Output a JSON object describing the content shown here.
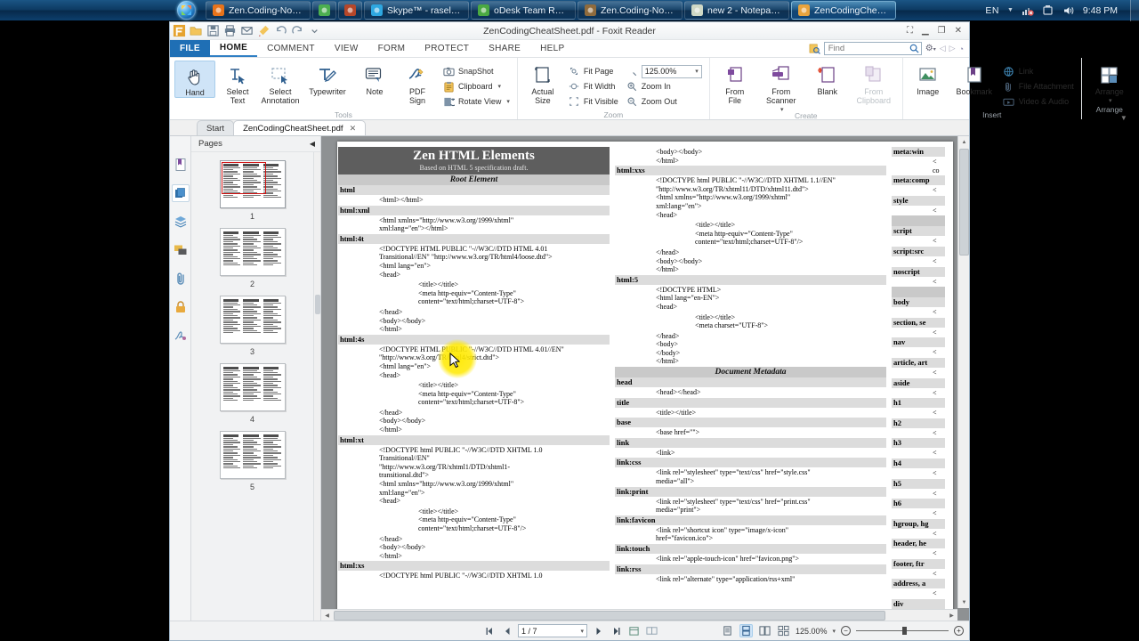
{
  "taskbar": {
    "items": [
      {
        "label": "Zen.Coding-Notep...",
        "icon": "firefox-icon",
        "color": "#e8731a",
        "active": false,
        "narrow": false
      },
      {
        "label": "",
        "icon": "chrome-icon",
        "color": "#4caf50",
        "active": false,
        "narrow": true
      },
      {
        "label": "",
        "icon": "app-icon",
        "color": "#b5472a",
        "active": false,
        "narrow": true
      },
      {
        "label": "Skype™ - raselahm...",
        "icon": "skype-icon",
        "color": "#2ea7e0",
        "active": false,
        "narrow": false
      },
      {
        "label": "oDesk Team Room",
        "icon": "odesk-icon",
        "color": "#4aa942",
        "active": false,
        "narrow": false
      },
      {
        "label": "Zen.Coding-Notep...",
        "icon": "notepadpp-icon",
        "color": "#8f6b3d",
        "active": false,
        "narrow": false
      },
      {
        "label": "new  2 - Notepad++",
        "icon": "notepadpp-icon",
        "color": "#cfd8c5",
        "active": false,
        "narrow": false
      },
      {
        "label": "ZenCodingCheatS...",
        "icon": "foxit-icon",
        "color": "#e8a33d",
        "active": true,
        "narrow": false
      }
    ],
    "tray": {
      "language": "EN",
      "icons": [
        "network-error-icon",
        "flash-drive-icon",
        "volume-icon"
      ],
      "clock": "9:48 PM"
    }
  },
  "window": {
    "title": "ZenCodingCheatSheet.pdf - Foxit Reader",
    "controls": [
      "restore-layout-icon",
      "minimize-icon",
      "maximize-icon",
      "close-icon"
    ],
    "quick_access": [
      "foxit-logo-icon",
      "open-icon",
      "save-icon",
      "print-icon",
      "email-icon",
      "highlight-icon",
      "undo-icon",
      "redo-icon",
      "customize-icon"
    ]
  },
  "ribbon": {
    "tabs": [
      {
        "label": "FILE",
        "type": "file"
      },
      {
        "label": "HOME",
        "active": true
      },
      {
        "label": "COMMENT",
        "active": false
      },
      {
        "label": "VIEW",
        "active": false
      },
      {
        "label": "FORM",
        "active": false
      },
      {
        "label": "PROTECT",
        "active": false
      },
      {
        "label": "SHARE",
        "active": false
      },
      {
        "label": "HELP",
        "active": false
      }
    ],
    "find": {
      "placeholder": "Find",
      "value": ""
    },
    "groups": [
      {
        "title": "Tools",
        "big": [
          {
            "label": "Hand",
            "icon": "hand-icon",
            "selected": true
          },
          {
            "label": "Select\nText",
            "icon": "select-text-icon",
            "selected": false
          },
          {
            "label": "Select\nAnnotation",
            "icon": "select-annotation-icon",
            "selected": false
          },
          {
            "label": "Typewriter",
            "icon": "typewriter-icon",
            "selected": false
          },
          {
            "label": "Note",
            "icon": "note-icon",
            "selected": false
          },
          {
            "label": "PDF\nSign",
            "icon": "pdf-sign-icon",
            "selected": false,
            "dropdown": true
          }
        ],
        "small": [
          {
            "label": "SnapShot",
            "icon": "snapshot-icon",
            "dropdown": false
          },
          {
            "label": "Clipboard",
            "icon": "clipboard-icon",
            "dropdown": true
          },
          {
            "label": "Rotate View",
            "icon": "rotate-view-icon",
            "dropdown": true
          }
        ]
      },
      {
        "title": "Zoom",
        "big": [
          {
            "label": "Actual\nSize",
            "icon": "actual-size-icon",
            "selected": false
          }
        ],
        "small": [
          {
            "label": "Fit Page",
            "icon": "fit-page-icon",
            "dropdown": false
          },
          {
            "label": "Fit Width",
            "icon": "fit-width-icon",
            "dropdown": false
          },
          {
            "label": "Fit Visible",
            "icon": "fit-visible-icon",
            "dropdown": false
          }
        ],
        "small2": [
          {
            "label": "125.00%",
            "icon": "magnify-icon",
            "type": "combo"
          },
          {
            "label": "Zoom In",
            "icon": "zoom-in-icon"
          },
          {
            "label": "Zoom Out",
            "icon": "zoom-out-icon"
          }
        ]
      },
      {
        "title": "Create",
        "big": [
          {
            "label": "From\nFile",
            "icon": "from-file-icon",
            "selected": false
          },
          {
            "label": "From\nScanner",
            "icon": "from-scanner-icon",
            "selected": false,
            "dropdown": true
          },
          {
            "label": "Blank",
            "icon": "blank-page-icon",
            "selected": false
          },
          {
            "label": "From\nClipboard",
            "icon": "from-clipboard-icon",
            "selected": false,
            "disabled": true
          }
        ],
        "small": []
      },
      {
        "title": "Insert",
        "big": [
          {
            "label": "Image",
            "icon": "image-icon",
            "selected": false
          },
          {
            "label": "Bookmark",
            "icon": "bookmark-icon",
            "selected": false
          }
        ],
        "small": [
          {
            "label": "Link",
            "icon": "link-icon",
            "dropdown": false
          },
          {
            "label": "File Attachment",
            "icon": "file-attachment-icon",
            "dropdown": false
          },
          {
            "label": "Video & Audio",
            "icon": "video-audio-icon",
            "dropdown": false
          }
        ]
      },
      {
        "title": "Arrange",
        "big": [
          {
            "label": "Arrange",
            "icon": "arrange-icon",
            "selected": false,
            "dropdown": true
          }
        ],
        "small": []
      }
    ]
  },
  "doc_tabs": [
    {
      "label": "Start",
      "active": false,
      "closable": false
    },
    {
      "label": "ZenCodingCheatSheet.pdf",
      "active": true,
      "closable": true,
      "close_glyph": "✕"
    }
  ],
  "sidebar": {
    "nav_icons": [
      {
        "name": "bookmark-panel-icon",
        "active": false
      },
      {
        "name": "pages-panel-icon",
        "active": true
      },
      {
        "name": "layers-panel-icon",
        "active": false
      },
      {
        "name": "comments-panel-icon",
        "active": false
      },
      {
        "name": "attachments-panel-icon",
        "active": false
      },
      {
        "name": "security-panel-icon",
        "active": false
      },
      {
        "name": "signatures-panel-icon",
        "active": false
      }
    ],
    "panel_title": "Pages",
    "collapse_glyph": "◀",
    "thumbnails": [
      {
        "number": "1",
        "current": true
      },
      {
        "number": "2",
        "current": false
      },
      {
        "number": "3",
        "current": false
      },
      {
        "number": "4",
        "current": false
      },
      {
        "number": "5",
        "current": false
      }
    ]
  },
  "statusbar": {
    "first_page_glyph": "⏮",
    "prev_page_glyph": "◀",
    "next_page_glyph": "▶",
    "last_page_glyph": "⏭",
    "page_value": "1 / 7",
    "page_dropdown_glyph": "▾",
    "extra_buttons": [
      "fit-page-status-icon",
      "reflow-status-icon"
    ],
    "view_modes": [
      {
        "name": "single-page-view-icon",
        "selected": false
      },
      {
        "name": "continuous-view-icon",
        "selected": true
      },
      {
        "name": "facing-view-icon",
        "selected": false
      },
      {
        "name": "continuous-facing-view-icon",
        "selected": false
      }
    ],
    "zoom_label": "125.00%",
    "zoom_dropdown_glyph": "▾",
    "zoom_out_glyph": "−",
    "zoom_in_glyph": "+"
  },
  "pdf": {
    "title": "Zen HTML Elements",
    "subtitle": "Based on HTML 5 specification draft.",
    "columns": [
      {
        "id": "left",
        "blocks": [
          {
            "type": "section",
            "text": "Root Element"
          },
          {
            "type": "key",
            "text": "html"
          },
          {
            "type": "code",
            "indent": 1,
            "text": "<html></html>"
          },
          {
            "type": "key",
            "text": "html:xml"
          },
          {
            "type": "code",
            "indent": 1,
            "text": "<html xmlns=\"http://www.w3.org/1999/xhtml\"\nxml:lang=\"en\"></html>"
          },
          {
            "type": "key",
            "text": "html:4t"
          },
          {
            "type": "code",
            "indent": 1,
            "text": "<!DOCTYPE HTML PUBLIC \"-//W3C//DTD HTML 4.01\nTransitional//EN\" \"http://www.w3.org/TR/html4/loose.dtd\">\n<html lang=\"en\">\n<head>"
          },
          {
            "type": "code",
            "indent": 2,
            "text": "<title></title>\n<meta http-equiv=\"Content-Type\"\ncontent=\"text/html;charset=UTF-8\">"
          },
          {
            "type": "code",
            "indent": 1,
            "text": "</head>\n<body></body>\n</html>"
          },
          {
            "type": "key",
            "text": "html:4s"
          },
          {
            "type": "code",
            "indent": 1,
            "text": "<!DOCTYPE HTML PUBLIC \"-//W3C//DTD HTML 4.01//EN\"\n\"http://www.w3.org/TR/html4/strict.dtd\">\n<html lang=\"en\">\n<head>"
          },
          {
            "type": "code",
            "indent": 2,
            "text": "<title></title>\n<meta http-equiv=\"Content-Type\"\ncontent=\"text/html;charset=UTF-8\">"
          },
          {
            "type": "code",
            "indent": 1,
            "text": "</head>\n<body></body>\n</html>"
          },
          {
            "type": "key",
            "text": "html:xt"
          },
          {
            "type": "code",
            "indent": 1,
            "text": "<!DOCTYPE html PUBLIC \"-//W3C//DTD XHTML 1.0\nTransitional//EN\"\n\"http://www.w3.org/TR/xhtml1/DTD/xhtml1-\ntransitional.dtd\">\n<html xmlns=\"http://www.w3.org/1999/xhtml\"\nxml:lang=\"en\">\n<head>"
          },
          {
            "type": "code",
            "indent": 2,
            "text": "<title></title>\n<meta http-equiv=\"Content-Type\"\ncontent=\"text/html;charset=UTF-8\"/>"
          },
          {
            "type": "code",
            "indent": 1,
            "text": "</head>\n<body></body>\n</html>"
          },
          {
            "type": "key",
            "text": "html:xs"
          },
          {
            "type": "code",
            "indent": 1,
            "text": "<!DOCTYPE html PUBLIC \"-//W3C//DTD XHTML 1.0"
          }
        ]
      },
      {
        "id": "middle",
        "blocks": [
          {
            "type": "code",
            "indent": 1,
            "text": "<body></body>\n</html>"
          },
          {
            "type": "key",
            "text": "html:xxs"
          },
          {
            "type": "code",
            "indent": 1,
            "text": "<!DOCTYPE html PUBLIC \"-//W3C//DTD XHTML 1.1//EN\"\n\"http://www.w3.org/TR/xhtml11/DTD/xhtml11.dtd\">\n<html xmlns=\"http://www.w3.org/1999/xhtml\"\nxml:lang=\"en\">\n<head>"
          },
          {
            "type": "code",
            "indent": 2,
            "text": "<title></title>\n<meta http-equiv=\"Content-Type\"\ncontent=\"text/html;charset=UTF-8\"/>"
          },
          {
            "type": "code",
            "indent": 1,
            "text": "</head>\n<body></body>\n</html>"
          },
          {
            "type": "key",
            "text": "html:5"
          },
          {
            "type": "code",
            "indent": 1,
            "text": "<!DOCTYPE HTML>\n<html lang=\"en-EN\">\n<head>"
          },
          {
            "type": "code",
            "indent": 2,
            "text": "<title></title>\n<meta charset=\"UTF-8\">"
          },
          {
            "type": "code",
            "indent": 1,
            "text": "</head>\n<body>\n</body>\n</html>"
          },
          {
            "type": "section",
            "text": "Document Metadata"
          },
          {
            "type": "key",
            "text": "head"
          },
          {
            "type": "code",
            "indent": 1,
            "text": "<head></head>"
          },
          {
            "type": "key",
            "text": "title"
          },
          {
            "type": "code",
            "indent": 1,
            "text": "<title></title>"
          },
          {
            "type": "key",
            "text": "base"
          },
          {
            "type": "code",
            "indent": 1,
            "text": "<base href=\"\">"
          },
          {
            "type": "key",
            "text": "link"
          },
          {
            "type": "code",
            "indent": 1,
            "text": "<link>"
          },
          {
            "type": "key",
            "text": "link:css"
          },
          {
            "type": "code",
            "indent": 1,
            "text": "<link rel=\"stylesheet\" type=\"text/css\" href=\"style.css\"\nmedia=\"all\">"
          },
          {
            "type": "key",
            "text": "link:print"
          },
          {
            "type": "code",
            "indent": 1,
            "text": "<link rel=\"stylesheet\" type=\"text/css\" href=\"print.css\"\nmedia=\"print\">"
          },
          {
            "type": "key",
            "text": "link:favicon"
          },
          {
            "type": "code",
            "indent": 1,
            "text": "<link rel=\"shortcut icon\" type=\"image/x-icon\"\nhref=\"favicon.ico\">"
          },
          {
            "type": "key",
            "text": "link:touch"
          },
          {
            "type": "code",
            "indent": 1,
            "text": "<link rel=\"apple-touch-icon\" href=\"favicon.png\">"
          },
          {
            "type": "key",
            "text": "link:rss"
          },
          {
            "type": "code",
            "indent": 1,
            "text": "<link rel=\"alternate\" type=\"application/rss+xml\""
          }
        ]
      },
      {
        "id": "right",
        "blocks": [
          {
            "type": "key",
            "text": "meta:win"
          },
          {
            "type": "code",
            "indent": 1,
            "text": "<\nco"
          },
          {
            "type": "key",
            "text": "meta:comp"
          },
          {
            "type": "code",
            "indent": 1,
            "text": "<"
          },
          {
            "type": "key",
            "text": "style"
          },
          {
            "type": "code",
            "indent": 1,
            "text": "<"
          },
          {
            "type": "section",
            "text": ""
          },
          {
            "type": "key",
            "text": "script"
          },
          {
            "type": "code",
            "indent": 1,
            "text": "<"
          },
          {
            "type": "key",
            "text": "script:src"
          },
          {
            "type": "code",
            "indent": 1,
            "text": "<"
          },
          {
            "type": "key",
            "text": "noscript"
          },
          {
            "type": "code",
            "indent": 1,
            "text": "<"
          },
          {
            "type": "section",
            "text": ""
          },
          {
            "type": "key",
            "text": "body"
          },
          {
            "type": "code",
            "indent": 1,
            "text": "<"
          },
          {
            "type": "key",
            "text": "section, se"
          },
          {
            "type": "code",
            "indent": 1,
            "text": "<"
          },
          {
            "type": "key",
            "text": "nav"
          },
          {
            "type": "code",
            "indent": 1,
            "text": "<"
          },
          {
            "type": "key",
            "text": "article, art"
          },
          {
            "type": "code",
            "indent": 1,
            "text": "<"
          },
          {
            "type": "key",
            "text": "aside"
          },
          {
            "type": "code",
            "indent": 1,
            "text": "<"
          },
          {
            "type": "key",
            "text": "h1"
          },
          {
            "type": "code",
            "indent": 1,
            "text": "<"
          },
          {
            "type": "key",
            "text": "h2"
          },
          {
            "type": "code",
            "indent": 1,
            "text": "<"
          },
          {
            "type": "key",
            "text": "h3"
          },
          {
            "type": "code",
            "indent": 1,
            "text": "<"
          },
          {
            "type": "key",
            "text": "h4"
          },
          {
            "type": "code",
            "indent": 1,
            "text": "<"
          },
          {
            "type": "key",
            "text": "h5"
          },
          {
            "type": "code",
            "indent": 1,
            "text": "<"
          },
          {
            "type": "key",
            "text": "h6"
          },
          {
            "type": "code",
            "indent": 1,
            "text": "<"
          },
          {
            "type": "key",
            "text": "hgroup, hg"
          },
          {
            "type": "code",
            "indent": 1,
            "text": "<"
          },
          {
            "type": "key",
            "text": "header, he"
          },
          {
            "type": "code",
            "indent": 1,
            "text": "<"
          },
          {
            "type": "key",
            "text": "footer, ftr"
          },
          {
            "type": "code",
            "indent": 1,
            "text": "<"
          },
          {
            "type": "key",
            "text": "address, a"
          },
          {
            "type": "code",
            "indent": 1,
            "text": "<"
          },
          {
            "type": "key",
            "text": "div"
          },
          {
            "type": "code",
            "indent": 1,
            "text": "<"
          }
        ]
      }
    ]
  }
}
